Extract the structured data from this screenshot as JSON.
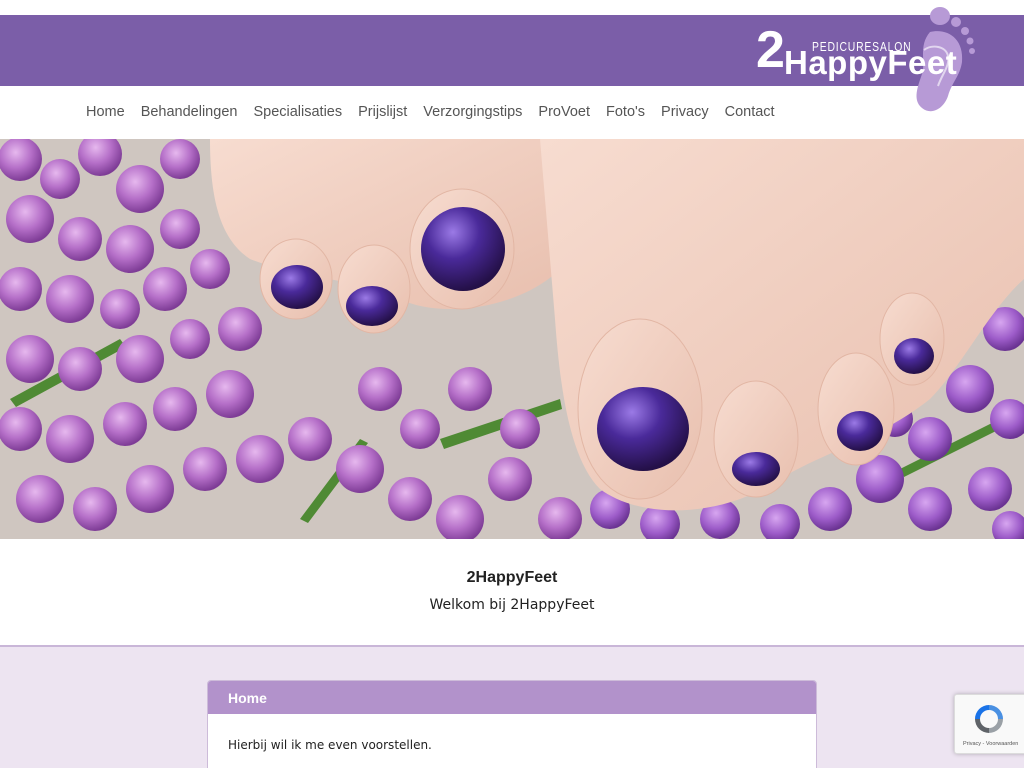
{
  "brand": {
    "number": "2",
    "subtitle": "PEDICURESALON",
    "name": "HappyFeet",
    "foot_icon": "footprint-icon",
    "banner_color": "#7b5ea8"
  },
  "nav": {
    "items": [
      {
        "label": "Home"
      },
      {
        "label": "Behandelingen"
      },
      {
        "label": "Specialisaties"
      },
      {
        "label": "Prijslijst"
      },
      {
        "label": "Verzorgingstips"
      },
      {
        "label": "ProVoet"
      },
      {
        "label": "Foto's"
      },
      {
        "label": "Privacy"
      },
      {
        "label": "Contact"
      }
    ]
  },
  "hero": {
    "image": "hero-photo-purple-pedicure-lilac-flowers"
  },
  "welcome": {
    "title": "2HappyFeet",
    "subtitle": "Welkom bij 2HappyFeet"
  },
  "card": {
    "header": "Home",
    "header_color": "#b292cb",
    "body": "Hierbij wil ik me even voorstellen."
  },
  "recaptcha": {
    "icon": "recaptcha-icon",
    "links": "Privacy - Voorwaarden"
  }
}
